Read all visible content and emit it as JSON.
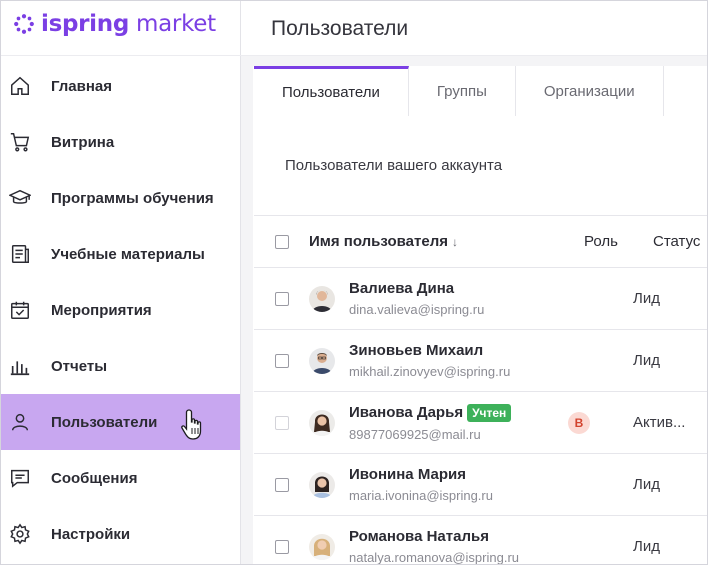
{
  "brand": {
    "logo_prefix": "ispring",
    "logo_suffix": "market",
    "color": "#7b3fe4"
  },
  "sidebar": {
    "items": [
      {
        "label": "Главная",
        "icon": "home-icon"
      },
      {
        "label": "Витрина",
        "icon": "cart-icon"
      },
      {
        "label": "Программы обучения",
        "icon": "graduation-cap-icon"
      },
      {
        "label": "Учебные материалы",
        "icon": "document-icon"
      },
      {
        "label": "Мероприятия",
        "icon": "calendar-check-icon"
      },
      {
        "label": "Отчеты",
        "icon": "bar-chart-icon"
      },
      {
        "label": "Пользователи",
        "icon": "user-icon",
        "active": true
      },
      {
        "label": "Сообщения",
        "icon": "message-icon"
      },
      {
        "label": "Настройки",
        "icon": "gear-icon"
      }
    ],
    "active_color": "#c8a7f0"
  },
  "header": {
    "title": "Пользователи"
  },
  "tabs": [
    {
      "label": "Пользователи",
      "active": true
    },
    {
      "label": "Группы"
    },
    {
      "label": "Организации"
    }
  ],
  "subtitle": "Пользователи вашего аккаунта",
  "table": {
    "columns": {
      "name": "Имя пользователя",
      "sort_indicator": "↓",
      "role": "Роль",
      "status": "Статус"
    },
    "rows": [
      {
        "name": "Валиева Дина",
        "email": "dina.valieva@ispring.ru",
        "role": "",
        "status": "Лид",
        "badge": ""
      },
      {
        "name": "Зиновьев Михаил",
        "email": "mikhail.zinovyev@ispring.ru",
        "role": "",
        "status": "Лид",
        "badge": ""
      },
      {
        "name": "Иванова Дарья",
        "email": "89877069925@mail.ru",
        "role": "B",
        "status": "Актив...",
        "badge": "Учтен"
      },
      {
        "name": "Ивонина Мария",
        "email": "maria.ivonina@ispring.ru",
        "role": "",
        "status": "Лид",
        "badge": ""
      },
      {
        "name": "Романова Наталья",
        "email": "natalya.romanova@ispring.ru",
        "role": "",
        "status": "Лид",
        "badge": ""
      }
    ]
  }
}
